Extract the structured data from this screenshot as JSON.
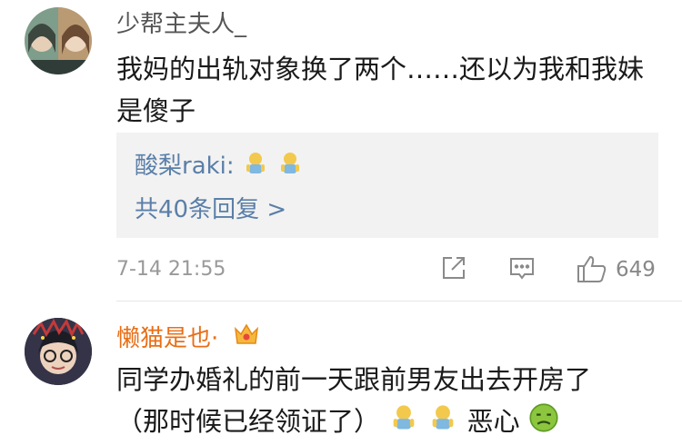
{
  "comments": [
    {
      "username": "少帮主夫人_",
      "line1": "我妈的出轨对象换了两个……还以为我和我妹",
      "line2": "是傻子",
      "reply": {
        "preview_user": "酸梨raki:",
        "preview_emojis": [
          "dog-doll-emoji",
          "dog-doll-emoji"
        ],
        "more_label": "共40条回复 >"
      },
      "time": "7-14 21:55",
      "actions": {
        "share_icon": "share-icon",
        "comment_icon": "comment-icon",
        "like_icon": "thumbs-up-icon",
        "like_count": "649"
      }
    },
    {
      "username": "懒猫是也·",
      "badge_icon": "vip-crown-icon",
      "line1": "同学办婚礼的前一天跟前男友出去开房了",
      "line2_text": "（那时候已经领证了）",
      "line2_tail": "恶心",
      "line2_emojis": [
        "dog-doll-emoji",
        "dog-doll-emoji",
        "sick-emoji"
      ]
    }
  ],
  "colors": {
    "username_default": "#555555",
    "username_vip": "#e86f17",
    "reply_link": "#5a7fa8",
    "meta_gray": "#999999",
    "reply_bg": "#f2f2f2"
  }
}
